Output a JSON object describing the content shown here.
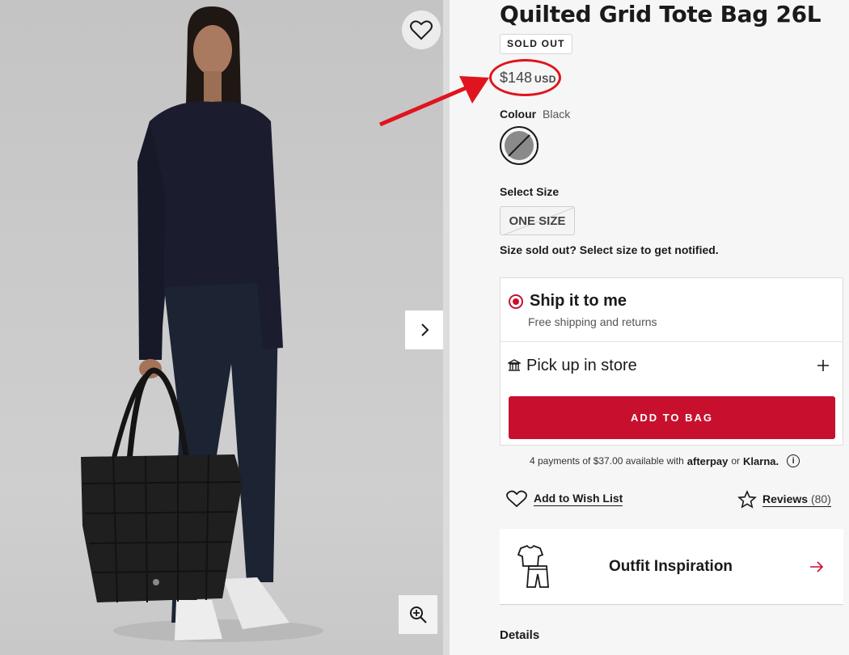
{
  "product": {
    "title": "Quilted Grid Tote Bag 26L",
    "badge": "SOLD OUT",
    "price": "$148",
    "currency": "USD"
  },
  "colour": {
    "label": "Colour",
    "value": "Black"
  },
  "size": {
    "label": "Select Size",
    "options": [
      "ONE SIZE"
    ],
    "sold_out_note": "Size sold out? Select size to get notified."
  },
  "fulfilment": {
    "ship_title": "Ship it to me",
    "ship_sub": "Free shipping and returns",
    "pickup_label": "Pick up in store",
    "add_to_bag": "ADD TO BAG"
  },
  "payment_note": {
    "text": "4 payments of $37.00 available with",
    "brand1": "afterpay",
    "or": "or",
    "brand2": "Klarna.",
    "info": "i"
  },
  "actions": {
    "wish_list": "Add to Wish List",
    "reviews": "Reviews",
    "reviews_count": "(80)"
  },
  "outfit": {
    "title": "Outfit Inspiration"
  },
  "details": {
    "label": "Details"
  },
  "colors": {
    "accent": "#c8102e",
    "annotation": "#e0141e"
  },
  "icons": [
    "heart-icon",
    "chevron-right-icon",
    "zoom-in-icon",
    "store-icon",
    "plus-icon",
    "star-icon",
    "outfit-icon",
    "arrow-right-icon"
  ]
}
